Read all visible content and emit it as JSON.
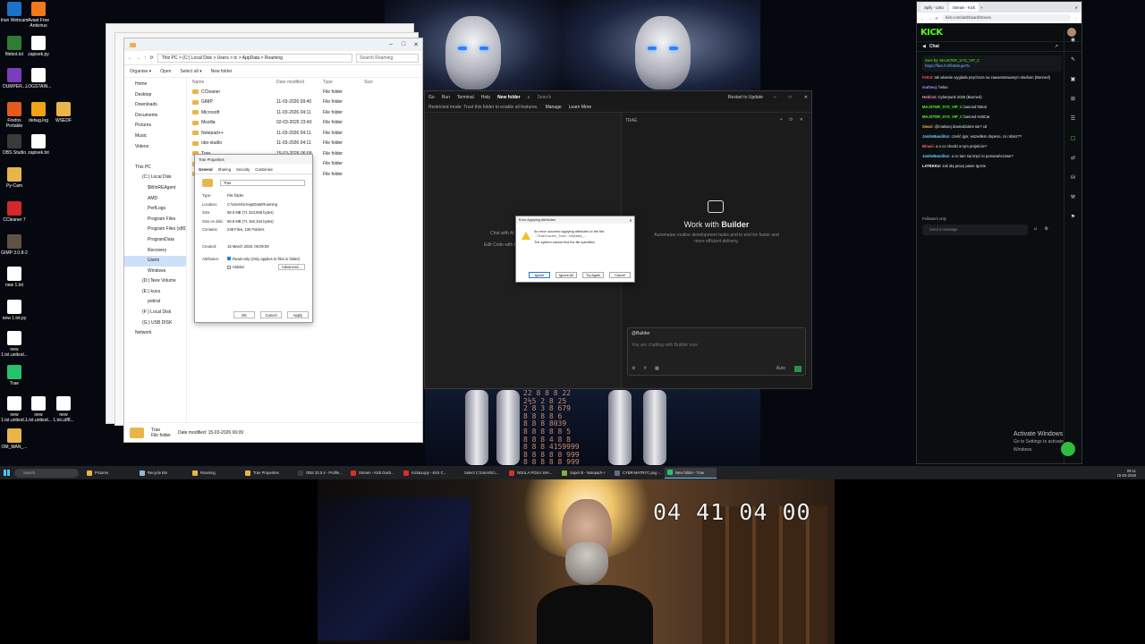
{
  "desktop": {
    "icons": [
      {
        "label": "Iriun Webcam",
        "color": "#1b72c9"
      },
      {
        "label": "Avast Free Antivirus",
        "color": "#f27a1a"
      },
      {
        "label": "filebot.txt",
        "color": "#2e7d32"
      },
      {
        "label": "zapisek.py",
        "color": "#ffffff"
      },
      {
        "label": "DUMPER...",
        "color": "#7a3dbd"
      },
      {
        "label": "LOGSTAIN...",
        "color": "#ffffff"
      },
      {
        "label": "Firefox Portable",
        "color": "#e55a1c"
      },
      {
        "label": "debug.log",
        "color": "#f0a21a"
      },
      {
        "label": "WSEDF",
        "color": "#e8b54a"
      },
      {
        "label": "OBS Studio",
        "color": "#3a3a3a"
      },
      {
        "label": "zapisek.txt",
        "color": "#ffffff"
      },
      {
        "label": "Py-Cam",
        "color": "#e8b54a"
      },
      {
        "label": "CCleaner 7",
        "color": "#d12a2a"
      },
      {
        "label": "GIMP 3.0.8-2",
        "color": "#5f5444"
      },
      {
        "label": "new 1.txt",
        "color": "#ffffff"
      },
      {
        "label": "new 1.txt.py",
        "color": "#ffffff"
      },
      {
        "label": "new 1.txt.unikod...",
        "color": "#ffffff"
      },
      {
        "label": "Trae",
        "color": "#25c26e"
      },
      {
        "label": "new 1.txt.unikod...",
        "color": "#ffffff"
      },
      {
        "label": "new 1.txt.unikod...",
        "color": "#ffffff"
      },
      {
        "label": "new 1.txt.utf8...",
        "color": "#ffffff"
      },
      {
        "label": "OM_MAN_...",
        "color": "#e8b54a"
      }
    ],
    "digits": "22 8 8 8 22\n2½5 2 8 25\n2 8 3 8 679\n8 8 8 8 6\n8 8 8 8039\n8 8 8 8 8 5\n8 8 8 4 8 8\n8 8 8 4159999\n8 8 8 8 8 999\n8 8 8 8 8 999\n8 8 8 8 8 8 8 8\n8 8 8 8 8 9 9\n8 8 8 8 8 8 8\n8 8 8 8 8 8 8\n8 8 8 8 8 8 8"
  },
  "explorer": {
    "address": "This PC  >  (C:) Local Disk  >  Users  >  tc  >  AppData  >  Roaming",
    "search_placeholder": "Search Roaming",
    "toolbar": [
      "Organise ▾",
      "Open",
      "Select all ▾",
      "New folder"
    ],
    "nav": [
      {
        "label": "Home",
        "level": 0
      },
      {
        "label": "Desktop",
        "level": 0
      },
      {
        "label": "Downloads",
        "level": 0
      },
      {
        "label": "Documents",
        "level": 0
      },
      {
        "label": "Pictures",
        "level": 0
      },
      {
        "label": "Music",
        "level": 0
      },
      {
        "label": "Videos",
        "level": 0
      },
      {
        "label": "",
        "level": 0
      },
      {
        "label": "This PC",
        "level": 0
      },
      {
        "label": "(C:) Local Disk",
        "level": 1
      },
      {
        "label": "$WinREAgent",
        "level": 2
      },
      {
        "label": "AMD",
        "level": 2
      },
      {
        "label": "PerfLogs",
        "level": 2
      },
      {
        "label": "Program Files",
        "level": 2
      },
      {
        "label": "Program Files (x86)",
        "level": 2
      },
      {
        "label": "ProgramData",
        "level": 2
      },
      {
        "label": "Recovery",
        "level": 2
      },
      {
        "label": "Users",
        "level": 2,
        "selected": true
      },
      {
        "label": "Windows",
        "level": 2
      },
      {
        "label": "(D:) New Volume",
        "level": 1
      },
      {
        "label": "(E:) kuca",
        "level": 1
      },
      {
        "label": "pobrat",
        "level": 2
      },
      {
        "label": "(F:) Local Disk",
        "level": 1
      },
      {
        "label": "(G:) USB DISK",
        "level": 1
      },
      {
        "label": "Network",
        "level": 0
      }
    ],
    "columns": [
      "Name",
      "Date modified",
      "Type",
      "Size"
    ],
    "rows": [
      {
        "name": "CCleaner",
        "date": "",
        "type": "File folder"
      },
      {
        "name": "GIMP",
        "date": "11-03-2026 09:40",
        "type": "File folder"
      },
      {
        "name": "Microsoft",
        "date": "11-03-2026 04:11",
        "type": "File folder"
      },
      {
        "name": "Mozilla",
        "date": "02-03-2026 23:40",
        "type": "File folder"
      },
      {
        "name": "Notepad++",
        "date": "11-03-2026 04:11",
        "type": "File folder"
      },
      {
        "name": "obs-studio",
        "date": "11-03-2026 04:11",
        "type": "File folder"
      },
      {
        "name": "Trae",
        "date": "15-03-2026 06:09",
        "type": "File folder"
      },
      {
        "name": "",
        "date": "",
        "type": "File folder"
      },
      {
        "name": "",
        "date": "",
        "type": "File folder"
      }
    ],
    "status_name": "Trae",
    "status_type": "File folder",
    "status_date": "Date modified:   15-03-2026 06:09"
  },
  "props": {
    "title": "Trae Properties",
    "tabs": [
      "General",
      "Sharing",
      "Security",
      "Customise"
    ],
    "name": "Trae",
    "fields": [
      {
        "k": "Type:",
        "v": "File folder"
      },
      {
        "k": "Location:",
        "v": "C:\\Users\\tc\\AppData\\Roaming"
      },
      {
        "k": "Size:",
        "v": "68.0 MB (71 323,908 bytes)"
      },
      {
        "k": "Size on disk:",
        "v": "68.8 MB (71 182,334 bytes)"
      },
      {
        "k": "Contains:",
        "v": "238 Files, 130 Folders"
      },
      {
        "k": "",
        "v": ""
      },
      {
        "k": "Created:",
        "v": "15 March 2026, 06:09:09"
      }
    ],
    "attr_label": "Attributes:",
    "readonly": "Read-only (Only applies to files in folder)",
    "hidden": "Hidden",
    "advanced": "Advanced...",
    "buttons": [
      "OK",
      "Cancel",
      "Apply"
    ]
  },
  "ide": {
    "menu": [
      "Go",
      "Run",
      "Terminal",
      "Help"
    ],
    "folder": "New folder",
    "search_placeholder": "Search",
    "badge": "Restart to Update",
    "trust": "Restricted mode: Trust this folder to enable all features.",
    "manage": "Manage",
    "learn": "Learn More",
    "panel_title": "TRAE",
    "left_hint1": "Chat with AI",
    "left_hint2": "Edit Code with AI",
    "builder_title_a": "Work with",
    "builder_title_b": "Builder",
    "builder_sub": "Automates routine development tasks and to end for faster and more efficient delivery.",
    "chat_tag": "@Builder",
    "chat_placeholder": "You are chatting with Builder now",
    "auto": "Auto"
  },
  "error": {
    "title": "Error Applying Attributes",
    "line1": "An error occurred applying attributes to the file:",
    "line2": "...\\Trae\\Cache\\_Trae\\...\\obj\\data_...",
    "line3": "The system cannot find the file specified.",
    "buttons": [
      "Ignore",
      "Ignore All",
      "Try Again",
      "Cancel"
    ]
  },
  "browser": {
    "tabs": [
      "Spify - Listo",
      "Stream - Kick"
    ],
    "url": "kick.com/dashboard/stream",
    "logo": "KICK",
    "chat_title": "Chat",
    "pinned_by": "Sent by: MAJSTER_SYS_VIP_C",
    "pinned_link": "https://files.fm/f/b9vbujw7tv",
    "messages": [
      {
        "user": "h0Ital:",
        "text": "tak wlasnie wyglada psychoza na zaawansowanym stadium (Banned)",
        "color": "#ff4f4f"
      },
      {
        "user": "mattwoj:",
        "text": "heloo",
        "color": "#a58bff"
      },
      {
        "user": "HotiCat:",
        "text": "Cyberpunk 2026 (Banned)",
        "color": "#ff8fd1"
      },
      {
        "user": "MAJSTER_SYS_VIP_C",
        "text": "banned h0Ital",
        "color": "#53fc18"
      },
      {
        "user": "MAJSTER_SYS_VIP_C",
        "text": "banned HotiCat",
        "color": "#53fc18"
      },
      {
        "user": "Sieari:",
        "text": "@mattwoj dowiedziales sie? xd",
        "color": "#ffb347"
      },
      {
        "user": "JanitoBanditoz:",
        "text": "cześć Igor, wszedłem dopiero, co robisz??",
        "color": "#6fd0ff"
      },
      {
        "user": "Binaci:",
        "text": "a o co chodzi w tym projekcie?",
        "color": "#ff6b6b"
      },
      {
        "user": "JanitoBanditoz:",
        "text": "a co tam się kręci to pomarańczowe?",
        "color": "#6fd0ff"
      },
      {
        "user": "LATEKKU:",
        "text": "Jak idą pracę panie Igorze",
        "color": "#ffffff"
      }
    ],
    "followers_only": "Followers only",
    "send_placeholder": "Send a message",
    "activate_title": "Activate Windows",
    "activate_sub": "Go to Settings to activate Windows."
  },
  "taskbar": {
    "search": "Search",
    "items": [
      {
        "label": "Pictures",
        "color": "#e8b54a"
      },
      {
        "label": "Recycle Bin",
        "color": "#8fb6e0"
      },
      {
        "label": "Roaming",
        "color": "#e8b54a"
      },
      {
        "label": "Trae Properties",
        "color": "#e8b54a"
      },
      {
        "label": "OBS 32.0.4 - Profile...",
        "color": "#3a3a3a"
      },
      {
        "label": "Stream - Kick Dash...",
        "color": "#d93025"
      },
      {
        "label": "Kick&Lupy - Kick C...",
        "color": "#d93025"
      },
      {
        "label": "Select C:\\Users\\tc\\...",
        "color": "#1e1e1e"
      },
      {
        "label": "NOULA POSA 19H...",
        "color": "#d93025"
      },
      {
        "label": "Super B - Notepad++",
        "color": "#7cb342"
      },
      {
        "label": "CYBR-MATRYC.png -...",
        "color": "#5f6d8a"
      },
      {
        "label": "New folder - Trae",
        "color": "#25c26e",
        "active": true
      }
    ],
    "time": "09:11",
    "date": "15-03-2026"
  },
  "webcam": {
    "timecode": "04 41 04 00"
  }
}
